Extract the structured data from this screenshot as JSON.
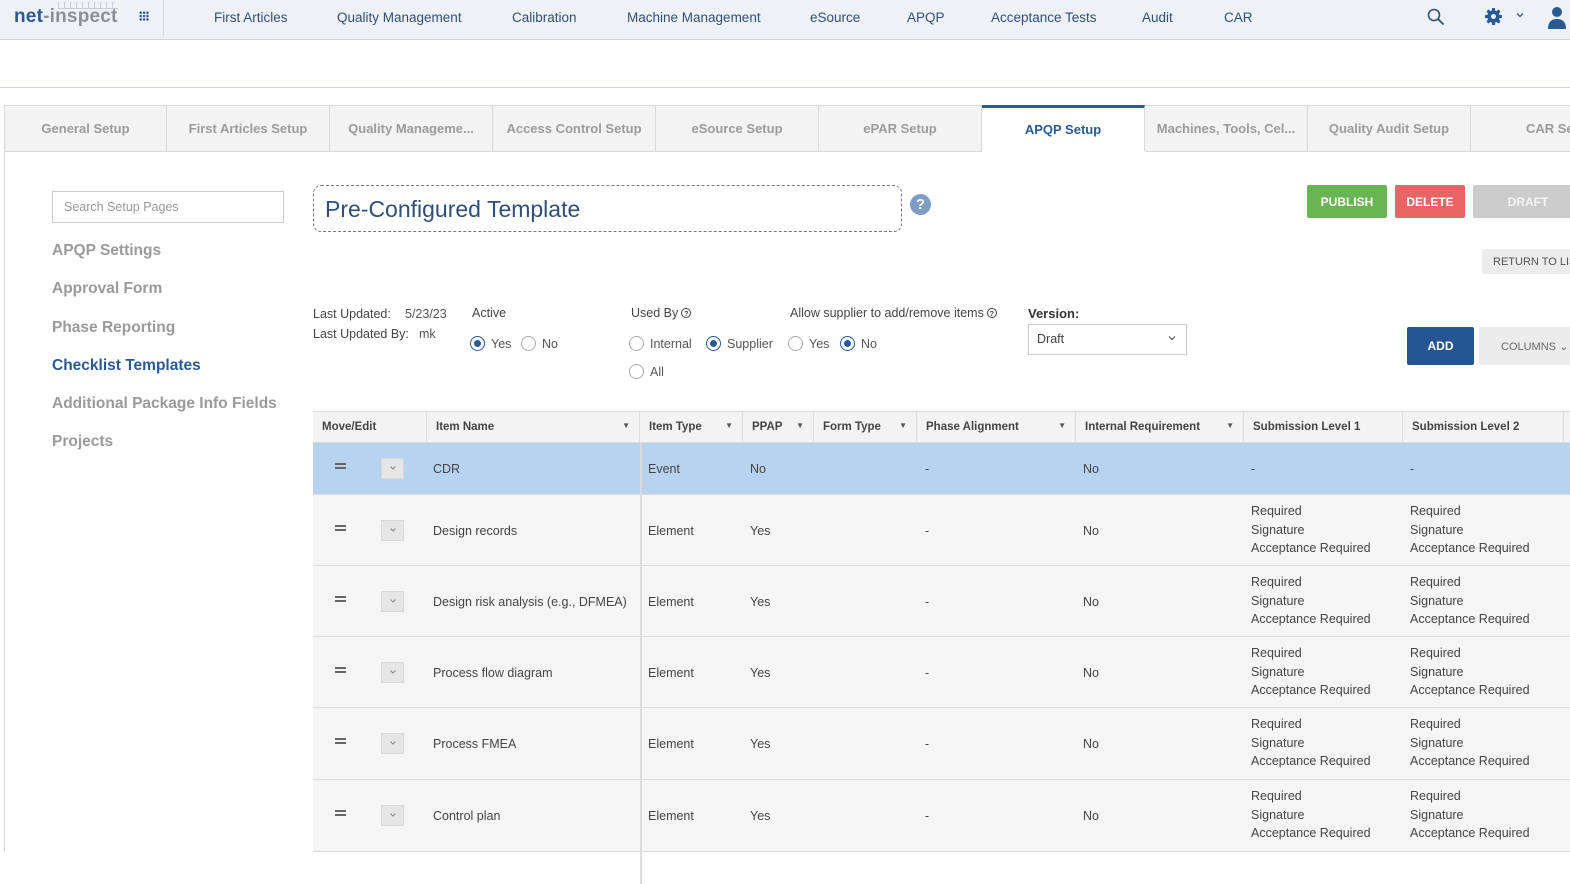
{
  "app": {
    "logo_part1": "net",
    "logo_part2": "-inspect",
    "nav": [
      "First Articles",
      "Quality Management",
      "Calibration",
      "Machine Management",
      "eSource",
      "APQP",
      "Acceptance Tests",
      "Audit",
      "CAR"
    ],
    "icons": [
      "apps-grid-icon",
      "search-icon",
      "gear-icon",
      "chevron-down-icon",
      "user-icon"
    ]
  },
  "tabs": [
    {
      "label": "General Setup",
      "active": false
    },
    {
      "label": "First Articles Setup",
      "active": false
    },
    {
      "label": "Quality Manageme...",
      "active": false
    },
    {
      "label": "Access Control Setup",
      "active": false
    },
    {
      "label": "eSource Setup",
      "active": false
    },
    {
      "label": "ePAR Setup",
      "active": false
    },
    {
      "label": "APQP Setup",
      "active": true
    },
    {
      "label": "Machines, Tools, Cel...",
      "active": false
    },
    {
      "label": "Quality Audit Setup",
      "active": false
    },
    {
      "label": "CAR Set",
      "active": false
    }
  ],
  "sidebar": {
    "search_placeholder": "Search Setup Pages",
    "items": [
      {
        "label": "APQP Settings",
        "active": false
      },
      {
        "label": "Approval Form",
        "active": false
      },
      {
        "label": "Phase Reporting",
        "active": false
      },
      {
        "label": "Checklist Templates",
        "active": true
      },
      {
        "label": "Additional Package Info Fields",
        "active": false
      },
      {
        "label": "Projects",
        "active": false
      }
    ]
  },
  "template": {
    "title": "Pre-Configured Template",
    "help_glyph": "?",
    "buttons": {
      "publish": "PUBLISH",
      "delete": "DELETE",
      "draft": "DRAFT",
      "return": "RETURN TO LIST",
      "add": "ADD",
      "columns": "COLUMNS"
    },
    "colors": {
      "publish": "#6ab553",
      "delete": "#e96464",
      "add": "#255694",
      "accent": "#2a5a93",
      "selected_row": "#b8d3f0"
    }
  },
  "meta": {
    "last_updated_label": "Last Updated:",
    "last_updated_value": "5/23/23",
    "last_updated_by_label": "Last Updated By:",
    "last_updated_by_value": "mk",
    "active": {
      "label": "Active",
      "options": [
        "Yes",
        "No"
      ],
      "selected": "Yes"
    },
    "used_by": {
      "label": "Used By",
      "options": [
        "Internal",
        "Supplier",
        "All"
      ],
      "selected": "Supplier"
    },
    "allow_supplier": {
      "label": "Allow supplier to add/remove items",
      "options": [
        "Yes",
        "No"
      ],
      "selected": "No"
    },
    "version": {
      "label": "Version:",
      "value": "Draft"
    }
  },
  "table": {
    "columns": [
      "Move/Edit",
      "Item Name",
      "Item Type",
      "PPAP",
      "Form Type",
      "Phase Alignment",
      "Internal Requirement",
      "Submission Level 1",
      "Submission Level 2"
    ],
    "filterable": [
      false,
      true,
      true,
      true,
      true,
      true,
      true,
      false,
      false
    ],
    "rows": [
      {
        "name": "CDR",
        "type": "Event",
        "ppap": "No",
        "form_type": "",
        "phase": "-",
        "internal": "No",
        "sub1": [
          "-"
        ],
        "sub2": [
          "-"
        ],
        "selected": true
      },
      {
        "name": "Design records",
        "type": "Element",
        "ppap": "Yes",
        "form_type": "",
        "phase": "-",
        "internal": "No",
        "sub1": [
          "Required",
          "Signature",
          "Acceptance Required"
        ],
        "sub2": [
          "Required",
          "Signature",
          "Acceptance Required"
        ],
        "selected": false
      },
      {
        "name": "Design risk analysis (e.g., DFMEA)",
        "type": "Element",
        "ppap": "Yes",
        "form_type": "",
        "phase": "-",
        "internal": "No",
        "sub1": [
          "Required",
          "Signature",
          "Acceptance Required"
        ],
        "sub2": [
          "Required",
          "Signature",
          "Acceptance Required"
        ],
        "selected": false
      },
      {
        "name": "Process flow diagram",
        "type": "Element",
        "ppap": "Yes",
        "form_type": "",
        "phase": "-",
        "internal": "No",
        "sub1": [
          "Required",
          "Signature",
          "Acceptance Required"
        ],
        "sub2": [
          "Required",
          "Signature",
          "Acceptance Required"
        ],
        "selected": false
      },
      {
        "name": "Process FMEA",
        "type": "Element",
        "ppap": "Yes",
        "form_type": "",
        "phase": "-",
        "internal": "No",
        "sub1": [
          "Required",
          "Signature",
          "Acceptance Required"
        ],
        "sub2": [
          "Required",
          "Signature",
          "Acceptance Required"
        ],
        "selected": false
      },
      {
        "name": "Control plan",
        "type": "Element",
        "ppap": "Yes",
        "form_type": "",
        "phase": "-",
        "internal": "No",
        "sub1": [
          "Required",
          "Signature",
          "Acceptance Required"
        ],
        "sub2": [
          "Required",
          "Signature",
          "Acceptance Required"
        ],
        "selected": false
      }
    ]
  }
}
